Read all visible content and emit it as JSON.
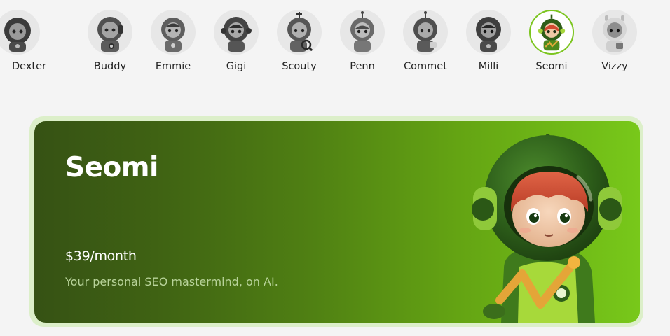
{
  "avatars": [
    {
      "name": "Dexter",
      "display": "Dexter",
      "selected": false
    },
    {
      "name": "Buddy",
      "display": "Buddy",
      "selected": false
    },
    {
      "name": "Emmie",
      "display": "Emmie",
      "selected": false
    },
    {
      "name": "Gigi",
      "display": "Gigi",
      "selected": false
    },
    {
      "name": "Scouty",
      "display": "Scouty",
      "selected": false
    },
    {
      "name": "Penn",
      "display": "Penn",
      "selected": false
    },
    {
      "name": "Commet",
      "display": "Commet",
      "selected": false
    },
    {
      "name": "Milli",
      "display": "Milli",
      "selected": false
    },
    {
      "name": "Seomi",
      "display": "Seomi",
      "selected": true
    },
    {
      "name": "Vizzy",
      "display": "Vizzy",
      "selected": false
    }
  ],
  "selected_card": {
    "title": "Seomi",
    "price": "$39/month",
    "description": "Your personal SEO mastermind, on AI."
  },
  "colors": {
    "accent_green": "#7cc520",
    "card_dark": "#365214",
    "card_light": "#78c81a",
    "card_border": "#dcefc9"
  }
}
